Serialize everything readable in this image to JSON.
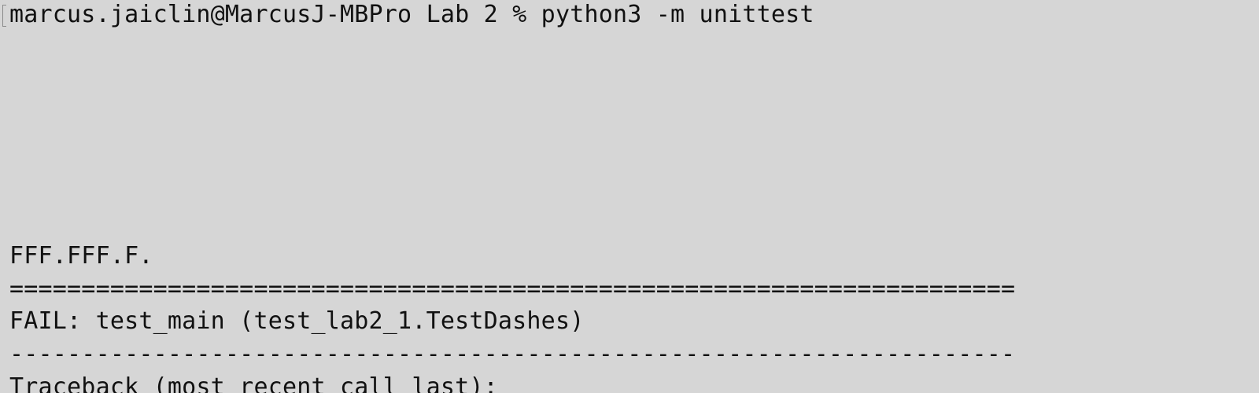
{
  "terminal": {
    "lines": [
      "marcus.jaiclin@MarcusJ-MBPro Lab 2 % python3 -m unittest",
      "FFF.FFF.F.",
      "======================================================================",
      "FAIL: test_main (test_lab2_1.TestDashes)",
      "----------------------------------------------------------------------",
      "Traceback (most recent call last):"
    ]
  }
}
